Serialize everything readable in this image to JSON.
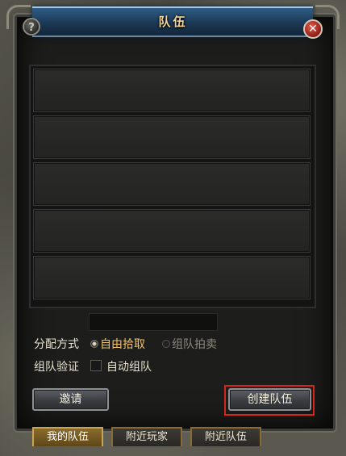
{
  "window": {
    "title": "队伍",
    "help_label": "?",
    "close_label": "✕"
  },
  "team_slots": [
    {
      "name": ""
    },
    {
      "name": ""
    },
    {
      "name": ""
    },
    {
      "name": ""
    },
    {
      "name": ""
    }
  ],
  "distribution": {
    "label": "分配方式",
    "options": [
      {
        "label": "自由拾取",
        "selected": true
      },
      {
        "label": "组队拍卖",
        "selected": false
      }
    ]
  },
  "verification": {
    "label": "组队验证",
    "auto_label": "自动组队",
    "auto_checked": false
  },
  "buttons": {
    "invite": "邀请",
    "create_team": "创建队伍"
  },
  "tabs": [
    {
      "label": "我的队伍",
      "active": true
    },
    {
      "label": "附近玩家",
      "active": false
    },
    {
      "label": "附近队伍",
      "active": false
    }
  ],
  "colors": {
    "title_text": "#f4d49a",
    "selected_option": "#f3c46a",
    "disabled_option": "#8e8a80",
    "highlight_border": "#d6261a"
  }
}
